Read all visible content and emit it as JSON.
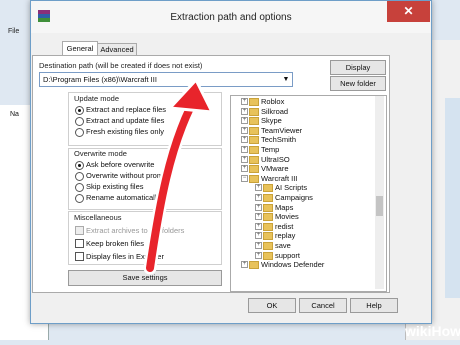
{
  "background_app": {
    "menu_label": "File",
    "list_label": "Na"
  },
  "dialog": {
    "title": "Extraction path and options",
    "close_glyph": "✕",
    "tabs": [
      "General",
      "Advanced"
    ],
    "destination_label": "Destination path (will be created if does not exist)",
    "destination_value": "D:\\Program Files (x86)\\Warcraft III",
    "display_button": "Display",
    "new_folder_button": "New folder",
    "update_mode": {
      "title": "Update mode",
      "options": [
        {
          "label": "Extract and replace files",
          "selected": true
        },
        {
          "label": "Extract and update files",
          "selected": false
        },
        {
          "label": "Fresh existing files only",
          "selected": false
        }
      ]
    },
    "overwrite_mode": {
      "title": "Overwrite mode",
      "options": [
        {
          "label": "Ask before overwrite",
          "selected": true
        },
        {
          "label": "Overwrite without prompt",
          "selected": false
        },
        {
          "label": "Skip existing files",
          "selected": false
        },
        {
          "label": "Rename automatically",
          "selected": false
        }
      ]
    },
    "miscellaneous": {
      "title": "Miscellaneous",
      "options": [
        {
          "label": "Extract archives to subfolders",
          "checked": false,
          "disabled": true
        },
        {
          "label": "Keep broken files",
          "checked": false,
          "disabled": false
        },
        {
          "label": "Display files in Explorer",
          "checked": false,
          "disabled": false
        }
      ]
    },
    "save_settings_button": "Save settings",
    "tree_items": [
      {
        "label": "Roblox"
      },
      {
        "label": "Silkroad"
      },
      {
        "label": "Skype"
      },
      {
        "label": "TeamViewer"
      },
      {
        "label": "TechSmith"
      },
      {
        "label": "Temp"
      },
      {
        "label": "UltraISO"
      },
      {
        "label": "VMware"
      },
      {
        "label": "Warcraft III"
      },
      {
        "label": "AI Scripts"
      },
      {
        "label": "Campaigns"
      },
      {
        "label": "Maps"
      },
      {
        "label": "Movies"
      },
      {
        "label": "redist"
      },
      {
        "label": "replay"
      },
      {
        "label": "save"
      },
      {
        "label": "support"
      },
      {
        "label": "Windows Defender"
      }
    ],
    "ok_button": "OK",
    "cancel_button": "Cancel",
    "help_button": "Help"
  },
  "watermark": {
    "part1": "wiki",
    "part2": "How"
  },
  "colors": {
    "accent_red": "#e8242b",
    "close_red": "#c7413b",
    "folder_yellow": "#e8c25a"
  }
}
